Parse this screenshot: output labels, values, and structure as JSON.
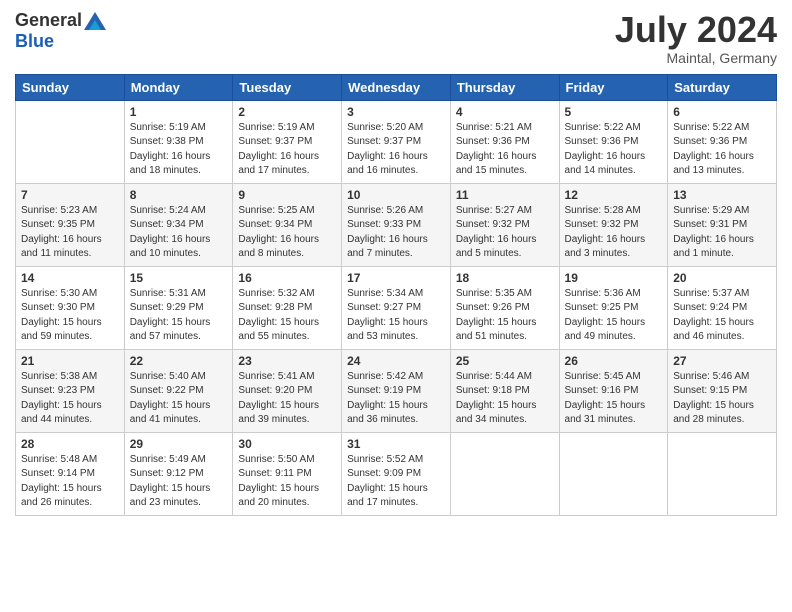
{
  "header": {
    "logo_general": "General",
    "logo_blue": "Blue",
    "month_year": "July 2024",
    "location": "Maintal, Germany"
  },
  "calendar": {
    "days_of_week": [
      "Sunday",
      "Monday",
      "Tuesday",
      "Wednesday",
      "Thursday",
      "Friday",
      "Saturday"
    ],
    "weeks": [
      [
        {
          "day": "",
          "content": ""
        },
        {
          "day": "1",
          "content": "Sunrise: 5:19 AM\nSunset: 9:38 PM\nDaylight: 16 hours\nand 18 minutes."
        },
        {
          "day": "2",
          "content": "Sunrise: 5:19 AM\nSunset: 9:37 PM\nDaylight: 16 hours\nand 17 minutes."
        },
        {
          "day": "3",
          "content": "Sunrise: 5:20 AM\nSunset: 9:37 PM\nDaylight: 16 hours\nand 16 minutes."
        },
        {
          "day": "4",
          "content": "Sunrise: 5:21 AM\nSunset: 9:36 PM\nDaylight: 16 hours\nand 15 minutes."
        },
        {
          "day": "5",
          "content": "Sunrise: 5:22 AM\nSunset: 9:36 PM\nDaylight: 16 hours\nand 14 minutes."
        },
        {
          "day": "6",
          "content": "Sunrise: 5:22 AM\nSunset: 9:36 PM\nDaylight: 16 hours\nand 13 minutes."
        }
      ],
      [
        {
          "day": "7",
          "content": "Sunrise: 5:23 AM\nSunset: 9:35 PM\nDaylight: 16 hours\nand 11 minutes."
        },
        {
          "day": "8",
          "content": "Sunrise: 5:24 AM\nSunset: 9:34 PM\nDaylight: 16 hours\nand 10 minutes."
        },
        {
          "day": "9",
          "content": "Sunrise: 5:25 AM\nSunset: 9:34 PM\nDaylight: 16 hours\nand 8 minutes."
        },
        {
          "day": "10",
          "content": "Sunrise: 5:26 AM\nSunset: 9:33 PM\nDaylight: 16 hours\nand 7 minutes."
        },
        {
          "day": "11",
          "content": "Sunrise: 5:27 AM\nSunset: 9:32 PM\nDaylight: 16 hours\nand 5 minutes."
        },
        {
          "day": "12",
          "content": "Sunrise: 5:28 AM\nSunset: 9:32 PM\nDaylight: 16 hours\nand 3 minutes."
        },
        {
          "day": "13",
          "content": "Sunrise: 5:29 AM\nSunset: 9:31 PM\nDaylight: 16 hours\nand 1 minute."
        }
      ],
      [
        {
          "day": "14",
          "content": "Sunrise: 5:30 AM\nSunset: 9:30 PM\nDaylight: 15 hours\nand 59 minutes."
        },
        {
          "day": "15",
          "content": "Sunrise: 5:31 AM\nSunset: 9:29 PM\nDaylight: 15 hours\nand 57 minutes."
        },
        {
          "day": "16",
          "content": "Sunrise: 5:32 AM\nSunset: 9:28 PM\nDaylight: 15 hours\nand 55 minutes."
        },
        {
          "day": "17",
          "content": "Sunrise: 5:34 AM\nSunset: 9:27 PM\nDaylight: 15 hours\nand 53 minutes."
        },
        {
          "day": "18",
          "content": "Sunrise: 5:35 AM\nSunset: 9:26 PM\nDaylight: 15 hours\nand 51 minutes."
        },
        {
          "day": "19",
          "content": "Sunrise: 5:36 AM\nSunset: 9:25 PM\nDaylight: 15 hours\nand 49 minutes."
        },
        {
          "day": "20",
          "content": "Sunrise: 5:37 AM\nSunset: 9:24 PM\nDaylight: 15 hours\nand 46 minutes."
        }
      ],
      [
        {
          "day": "21",
          "content": "Sunrise: 5:38 AM\nSunset: 9:23 PM\nDaylight: 15 hours\nand 44 minutes."
        },
        {
          "day": "22",
          "content": "Sunrise: 5:40 AM\nSunset: 9:22 PM\nDaylight: 15 hours\nand 41 minutes."
        },
        {
          "day": "23",
          "content": "Sunrise: 5:41 AM\nSunset: 9:20 PM\nDaylight: 15 hours\nand 39 minutes."
        },
        {
          "day": "24",
          "content": "Sunrise: 5:42 AM\nSunset: 9:19 PM\nDaylight: 15 hours\nand 36 minutes."
        },
        {
          "day": "25",
          "content": "Sunrise: 5:44 AM\nSunset: 9:18 PM\nDaylight: 15 hours\nand 34 minutes."
        },
        {
          "day": "26",
          "content": "Sunrise: 5:45 AM\nSunset: 9:16 PM\nDaylight: 15 hours\nand 31 minutes."
        },
        {
          "day": "27",
          "content": "Sunrise: 5:46 AM\nSunset: 9:15 PM\nDaylight: 15 hours\nand 28 minutes."
        }
      ],
      [
        {
          "day": "28",
          "content": "Sunrise: 5:48 AM\nSunset: 9:14 PM\nDaylight: 15 hours\nand 26 minutes."
        },
        {
          "day": "29",
          "content": "Sunrise: 5:49 AM\nSunset: 9:12 PM\nDaylight: 15 hours\nand 23 minutes."
        },
        {
          "day": "30",
          "content": "Sunrise: 5:50 AM\nSunset: 9:11 PM\nDaylight: 15 hours\nand 20 minutes."
        },
        {
          "day": "31",
          "content": "Sunrise: 5:52 AM\nSunset: 9:09 PM\nDaylight: 15 hours\nand 17 minutes."
        },
        {
          "day": "",
          "content": ""
        },
        {
          "day": "",
          "content": ""
        },
        {
          "day": "",
          "content": ""
        }
      ]
    ]
  }
}
